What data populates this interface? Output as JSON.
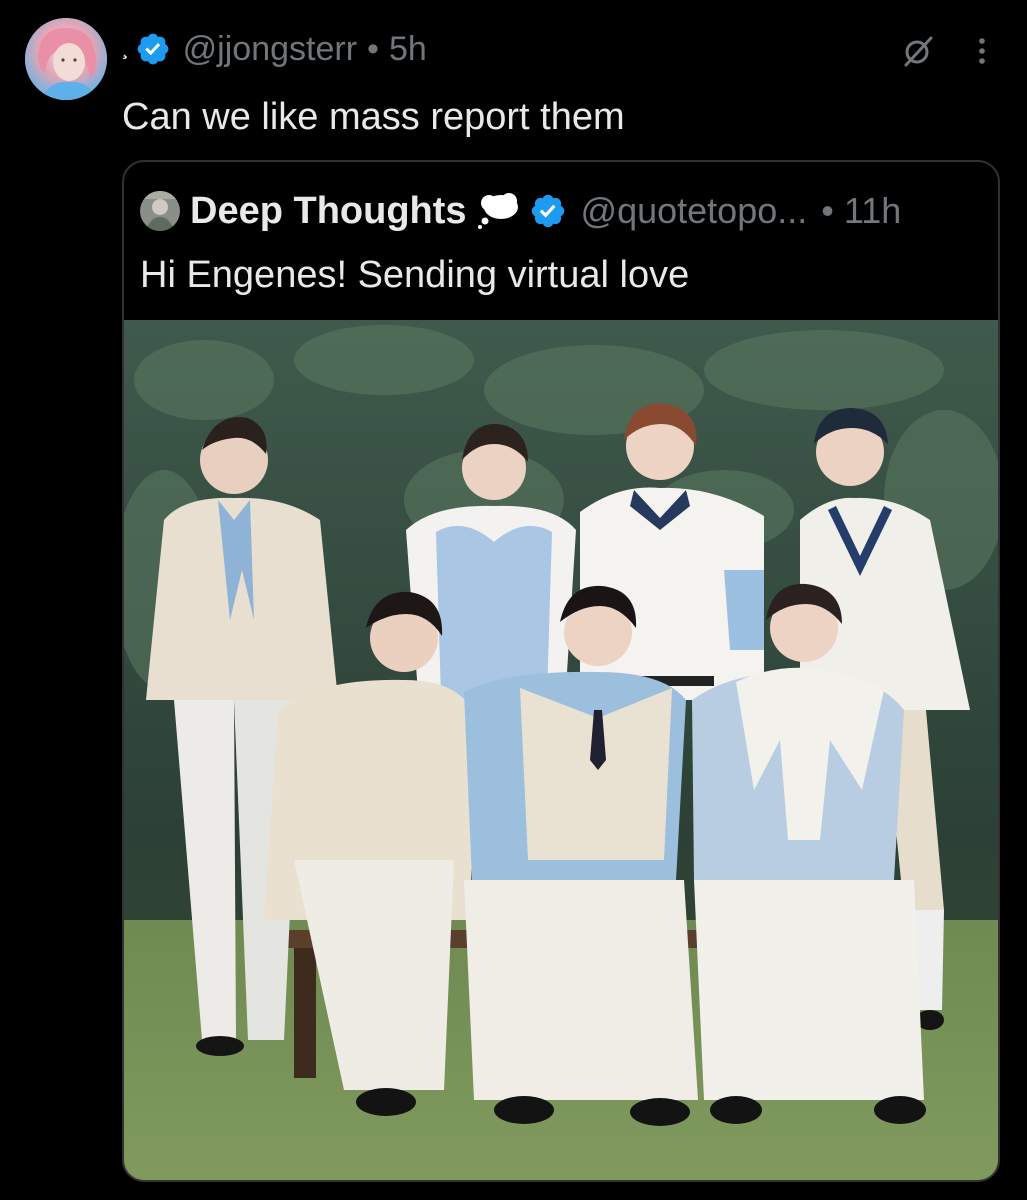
{
  "tweet": {
    "display_name": "¸",
    "handle": "@jjongsterr",
    "separator": "•",
    "time": "5h",
    "text": "Can we like mass report them",
    "icons": {
      "avatar": "profile-avatar",
      "verified": "verified-badge-icon",
      "grok": "grok-icon",
      "more": "more-options-icon"
    }
  },
  "quote": {
    "display_name": "Deep Thoughts",
    "handle": "@quotetopo...",
    "separator": "•",
    "time": "11h",
    "text": "Hi Engenes! Sending virtual love",
    "icons": {
      "avatar": "profile-avatar",
      "thought": "thought-balloon-icon",
      "verified": "verified-badge-icon"
    },
    "media": {
      "kind": "photo",
      "description_icon": "group-photo-image"
    }
  },
  "colors": {
    "background": "#000000",
    "text_primary": "#e7e9ea",
    "text_secondary": "#71767b",
    "border": "#2f3336",
    "verified_blue": "#1d9bf0"
  }
}
